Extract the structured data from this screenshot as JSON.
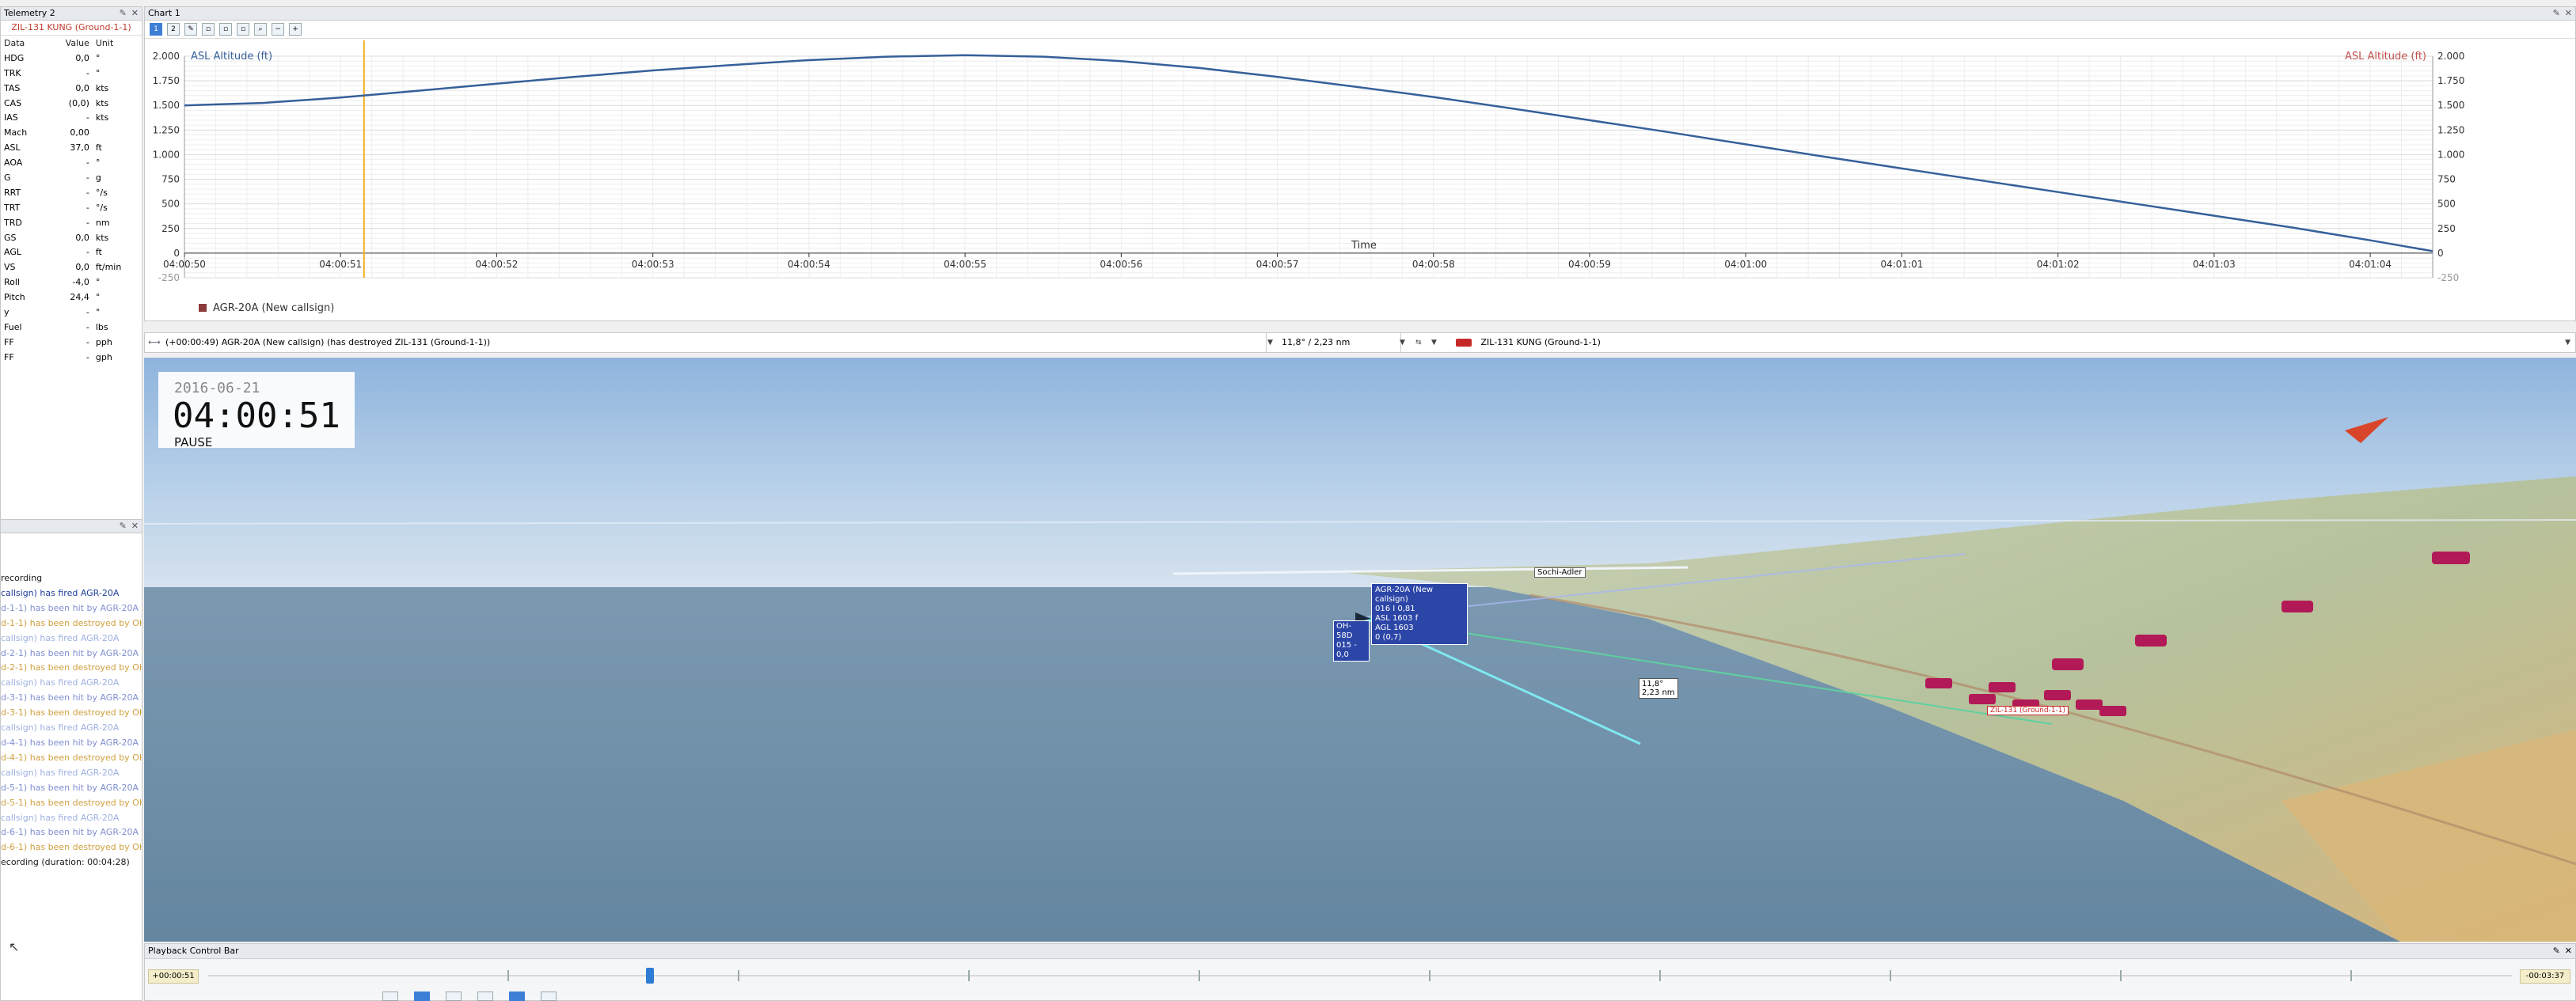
{
  "telemetry": {
    "title": "Telemetry 2",
    "object": "ZIL-131 KUNG (Ground-1-1)",
    "columns": {
      "data": "Data",
      "value": "Value",
      "unit": "Unit"
    },
    "rows": [
      {
        "name": "HDG",
        "value": "0,0",
        "unit": "°"
      },
      {
        "name": "TRK",
        "value": "-",
        "unit": "°"
      },
      {
        "name": "TAS",
        "value": "0,0",
        "unit": "kts"
      },
      {
        "name": "CAS",
        "value": "(0,0)",
        "unit": "kts"
      },
      {
        "name": "IAS",
        "value": "-",
        "unit": "kts"
      },
      {
        "name": "Mach",
        "value": "0,00",
        "unit": ""
      },
      {
        "name": "ASL",
        "value": "37,0",
        "unit": "ft"
      },
      {
        "name": "AOA",
        "value": "-",
        "unit": "°"
      },
      {
        "name": "G",
        "value": "-",
        "unit": "g"
      },
      {
        "name": "RRT",
        "value": "-",
        "unit": "°/s"
      },
      {
        "name": "TRT",
        "value": "-",
        "unit": "°/s"
      },
      {
        "name": "TRD",
        "value": "-",
        "unit": "nm"
      },
      {
        "name": "GS",
        "value": "0,0",
        "unit": "kts"
      },
      {
        "name": "AGL",
        "value": "-",
        "unit": "ft"
      },
      {
        "name": "VS",
        "value": "0,0",
        "unit": "ft/min"
      },
      {
        "name": "Roll",
        "value": "-4,0",
        "unit": "°"
      },
      {
        "name": "Pitch",
        "value": "24,4",
        "unit": "°"
      },
      {
        "name": "y",
        "value": "-",
        "unit": "°"
      },
      {
        "name": "Fuel",
        "value": "-",
        "unit": "lbs"
      },
      {
        "name": "FF",
        "value": "-",
        "unit": "pph"
      },
      {
        "name": "FF",
        "value": "-",
        "unit": "gph"
      }
    ]
  },
  "log": {
    "lines": [
      {
        "text": "recording",
        "color": "#1a1a1a"
      },
      {
        "text": "callsign) has fired AGR-20A",
        "color": "#1f3f9a"
      },
      {
        "text": "d-1-1) has been hit by AGR-20A",
        "color": "#7f8fd0"
      },
      {
        "text": "d-1-1) has been destroyed by OH",
        "color": "#d0a040"
      },
      {
        "text": "callsign) has fired AGR-20A",
        "color": "#9db0e0"
      },
      {
        "text": "d-2-1) has been hit by AGR-20A",
        "color": "#7f8fd0"
      },
      {
        "text": "d-2-1) has been destroyed by OH",
        "color": "#d0a040"
      },
      {
        "text": "callsign) has fired AGR-20A",
        "color": "#9db0e0"
      },
      {
        "text": "d-3-1) has been hit by AGR-20A",
        "color": "#7f8fd0"
      },
      {
        "text": "d-3-1) has been destroyed by OH",
        "color": "#d0a040"
      },
      {
        "text": "callsign) has fired AGR-20A",
        "color": "#9db0e0"
      },
      {
        "text": "d-4-1) has been hit by AGR-20A",
        "color": "#7f8fd0"
      },
      {
        "text": "d-4-1) has been destroyed by OH",
        "color": "#d0a040"
      },
      {
        "text": "callsign) has fired AGR-20A",
        "color": "#9db0e0"
      },
      {
        "text": "d-5-1) has been hit by AGR-20A",
        "color": "#7f8fd0"
      },
      {
        "text": "d-5-1) has been destroyed by OH",
        "color": "#d0a040"
      },
      {
        "text": "callsign) has fired AGR-20A",
        "color": "#9db0e0"
      },
      {
        "text": "d-6-1) has been hit by AGR-20A",
        "color": "#7f8fd0"
      },
      {
        "text": "d-6-1) has been destroyed by OH",
        "color": "#d0a040"
      },
      {
        "text": "ecording (duration: 00:04:28)",
        "color": "#1a1a1a"
      }
    ]
  },
  "chart": {
    "title": "Chart 1",
    "legend": "AGR-20A (New callsign)"
  },
  "chart_data": {
    "type": "line",
    "title": "",
    "ylabel_left": "ASL Altitude (ft)",
    "ylabel_right": "ASL Altitude (ft)",
    "xlabel": "Time",
    "ylim": [
      -250,
      2000
    ],
    "yticks": [
      "-250",
      "0",
      "250",
      "500",
      "750",
      "1.000",
      "1.250",
      "1.500",
      "1.750",
      "2.000"
    ],
    "ytick_values": [
      -250,
      0,
      250,
      500,
      750,
      1000,
      1250,
      1500,
      1750,
      2000
    ],
    "xlim": [
      50,
      64.4
    ],
    "xticks": [
      "04:00:50",
      "04:00:51",
      "04:00:52",
      "04:00:53",
      "04:00:54",
      "04:00:55",
      "04:00:56",
      "04:00:57",
      "04:00:58",
      "04:00:59",
      "04:01:00",
      "04:01:01",
      "04:01:02",
      "04:01:03",
      "04:01:04"
    ],
    "xtick_values": [
      50,
      51,
      52,
      53,
      54,
      55,
      56,
      57,
      58,
      59,
      60,
      61,
      62,
      63,
      64
    ],
    "cursor_x": 51.15,
    "grid": true,
    "series": [
      {
        "name": "AGR-20A (New callsign)",
        "color": "#36609a",
        "x": [
          50,
          50.5,
          51,
          51.5,
          52,
          52.5,
          53,
          53.5,
          54,
          54.5,
          55,
          55.5,
          56,
          56.5,
          57,
          57.5,
          58,
          58.5,
          59,
          59.5,
          60,
          60.5,
          61,
          61.5,
          62,
          62.5,
          63,
          63.5,
          64,
          64.4
        ],
        "y": [
          1500,
          1525,
          1580,
          1650,
          1720,
          1790,
          1855,
          1910,
          1960,
          1995,
          2010,
          1995,
          1950,
          1880,
          1790,
          1690,
          1585,
          1470,
          1350,
          1230,
          1105,
          980,
          860,
          740,
          620,
          500,
          380,
          260,
          130,
          20
        ]
      }
    ]
  },
  "event_bar": {
    "event": "(+00:00:49) AGR-20A (New callsign) (has destroyed ZIL-131 (Ground-1-1))",
    "distance": "11,8° / 2,23 nm",
    "target": "ZIL-131 KUNG (Ground-1-1)"
  },
  "view3d": {
    "date": "2016-06-21",
    "time": "04:00:51",
    "state": "PAUSE",
    "airport_label": "Sochi-Adler",
    "missile_label": [
      "AGR-20A (New callsign)",
      "016 I 0,81",
      "ASL 1603 f",
      "AGL 1603",
      "0 (0,7)"
    ],
    "shooter_label": [
      "OH-58D",
      "015 - 0,0"
    ],
    "range_label": [
      "11,8°",
      "2,23 nm"
    ],
    "target_label": "ZIL-131 (Ground-1-1)"
  },
  "playback": {
    "title": "Playback Control Bar",
    "elapsed": "+00:00:51",
    "remaining": "-00:03:37",
    "progress": 0.19
  }
}
